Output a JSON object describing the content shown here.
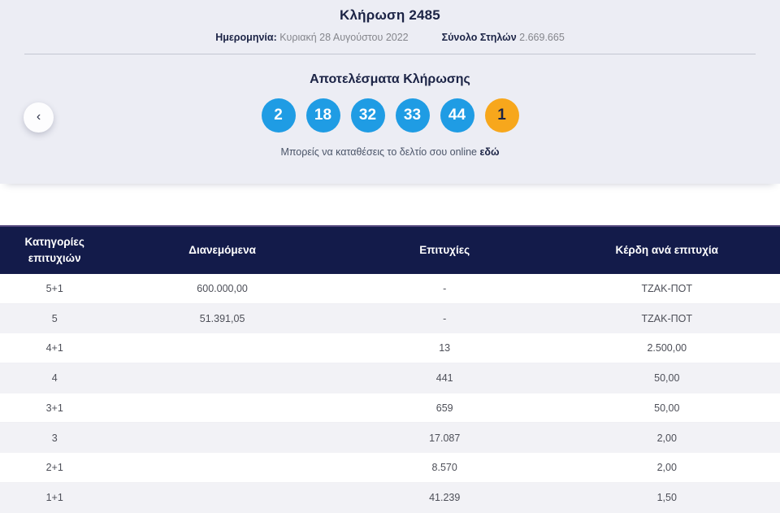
{
  "draw": {
    "title": "Κλήρωση 2485",
    "date_label": "Ημερομηνία:",
    "date_value": "Κυριακή 28 Αυγούστου 2022",
    "columns_label": "Σύνολο Στηλών",
    "columns_value": "2.669.665"
  },
  "nav": {
    "prev_icon": "‹"
  },
  "results": {
    "heading": "Αποτελέσματα Κλήρωσης",
    "numbers": [
      {
        "value": "2",
        "type": "main"
      },
      {
        "value": "18",
        "type": "main"
      },
      {
        "value": "32",
        "type": "main"
      },
      {
        "value": "33",
        "type": "main"
      },
      {
        "value": "44",
        "type": "main"
      },
      {
        "value": "1",
        "type": "joker"
      }
    ],
    "deposit_text": "Μπορείς να καταθέσεις το δελτίο σου online",
    "deposit_link": "εδώ"
  },
  "table": {
    "header_cells": [
      {
        "label": "Κατηγορίες επιτυχιών"
      },
      {
        "label": "Διανεμόμενα"
      },
      {
        "label": "Επιτυχίες"
      },
      {
        "label": "Κέρδη ανά επιτυχία"
      }
    ],
    "rows": [
      {
        "category": "5+1",
        "distributed": "600.000,00",
        "winners": "-",
        "payout": "ΤΖΑΚ-ΠΟΤ"
      },
      {
        "category": "5",
        "distributed": "51.391,05",
        "winners": "-",
        "payout": "ΤΖΑΚ-ΠΟΤ"
      },
      {
        "category": "4+1",
        "distributed": "",
        "winners": "13",
        "payout": "2.500,00"
      },
      {
        "category": "4",
        "distributed": "",
        "winners": "441",
        "payout": "50,00"
      },
      {
        "category": "3+1",
        "distributed": "",
        "winners": "659",
        "payout": "50,00"
      },
      {
        "category": "3",
        "distributed": "",
        "winners": "17.087",
        "payout": "2,00"
      },
      {
        "category": "2+1",
        "distributed": "",
        "winners": "8.570",
        "payout": "2,00"
      },
      {
        "category": "1+1",
        "distributed": "",
        "winners": "41.239",
        "payout": "1,50"
      }
    ]
  },
  "colors": {
    "ball_blue": "#1f9ce4",
    "ball_joker": "#f7a71c",
    "header_navy": "#131b4a",
    "section_bg": "#ecedf4",
    "row_alt": "#f2f2f6",
    "text_navy": "#1b2345",
    "text_gray": "#85868c",
    "cell_text": "#4d4f58"
  }
}
